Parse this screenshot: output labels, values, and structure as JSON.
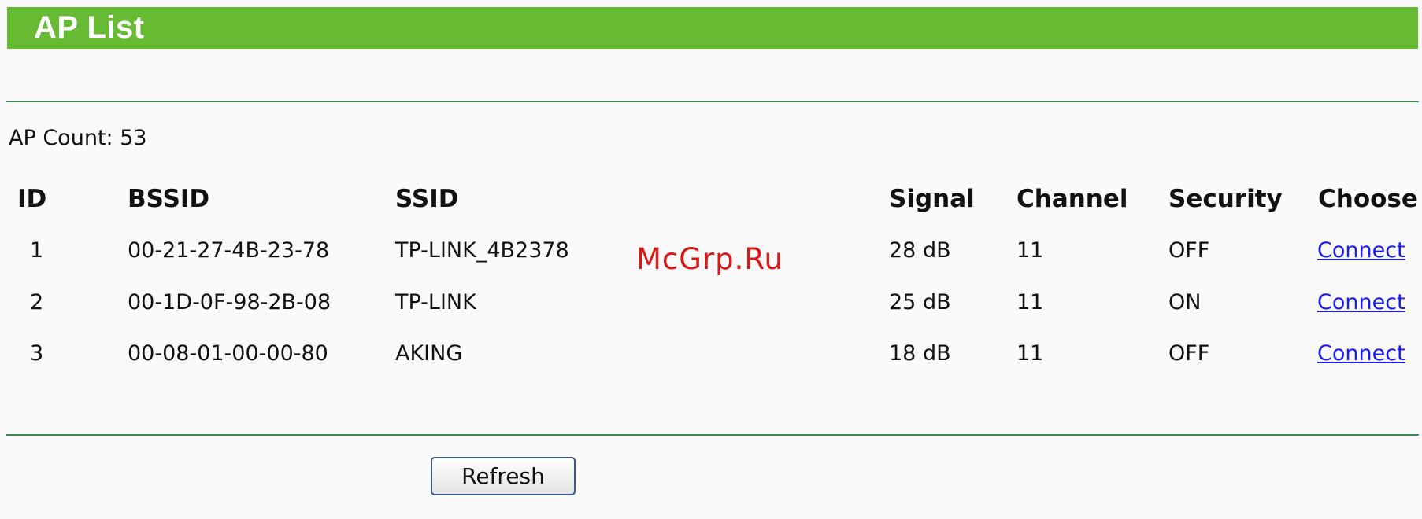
{
  "page": {
    "title": "AP List",
    "ap_count_label": "AP Count:",
    "ap_count": "53",
    "title_bar_color": "#66bb33",
    "rule_color": "#3a8a4f",
    "link_color": "#1a1aee"
  },
  "table": {
    "headers": [
      "ID",
      "BSSID",
      "SSID",
      "Signal",
      "Channel",
      "Security",
      "Choose"
    ],
    "rows": [
      {
        "id": "1",
        "bssid": "00-21-27-4B-23-78",
        "ssid": "TP-LINK_4B2378",
        "signal": "28 dB",
        "channel": "11",
        "security": "OFF",
        "choose": "Connect"
      },
      {
        "id": "2",
        "bssid": "00-1D-0F-98-2B-08",
        "ssid": "TP-LINK",
        "signal": "25 dB",
        "channel": "11",
        "security": "ON",
        "choose": "Connect"
      },
      {
        "id": "3",
        "bssid": "00-08-01-00-00-80",
        "ssid": "AKING",
        "signal": "18 dB",
        "channel": "11",
        "security": "OFF",
        "choose": "Connect"
      }
    ]
  },
  "watermark": "McGrp.Ru",
  "actions": {
    "refresh_label": "Refresh"
  }
}
